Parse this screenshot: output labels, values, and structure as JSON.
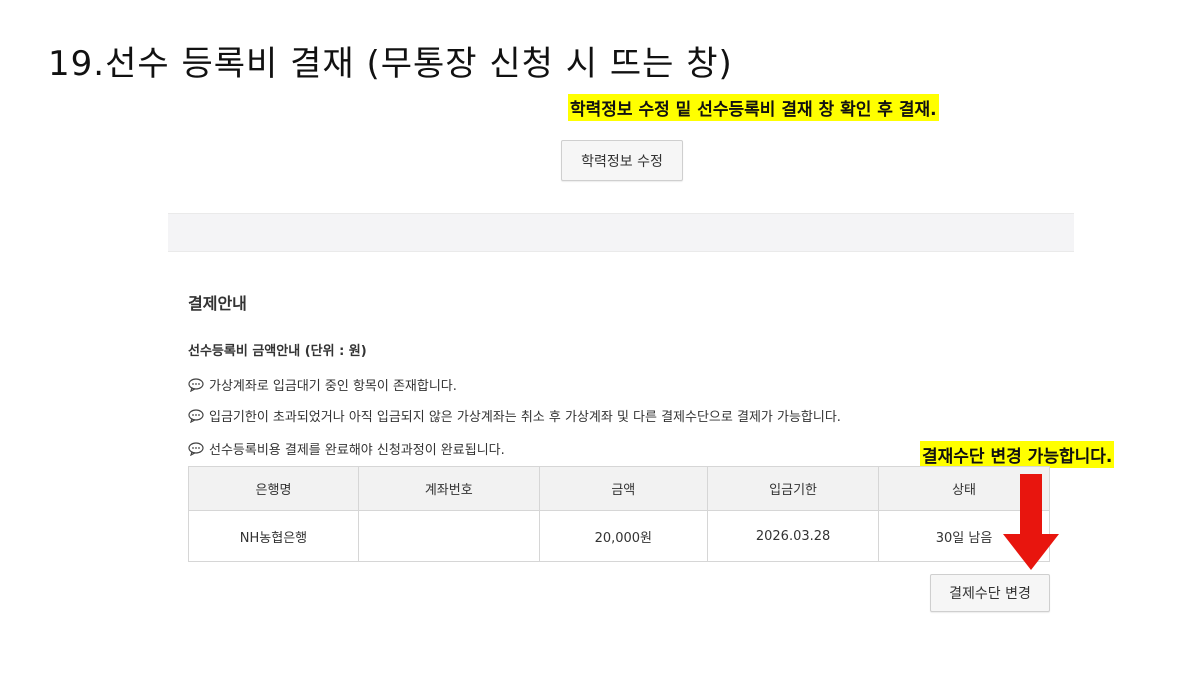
{
  "slide": {
    "title": "19.선수 등록비 결재 (무통장 신청 시 뜨는 창)"
  },
  "annotations": {
    "top": "학력정보 수정 밑 선수등록비 결재 창 확인 후 결재.",
    "right": "결재수단 변경 가능합니다."
  },
  "buttons": {
    "edit_education": "학력정보 수정",
    "change_payment": "결제수단 변경"
  },
  "payment": {
    "section_title": "결제안내",
    "fee_title": "선수등록비 금액안내 (단위 : 원)",
    "notes": [
      "가상계좌로 입금대기 중인 항목이 존재합니다.",
      "입금기한이 초과되었거나 아직 입금되지 않은 가상계좌는 취소 후 가상계좌 및 다른 결제수단으로 결제가 가능합니다.",
      "선수등록비용 결제를 완료해야 신청과정이 완료됩니다."
    ],
    "table": {
      "headers": [
        "은행명",
        "계좌번호",
        "금액",
        "입금기한",
        "상태"
      ],
      "rows": [
        {
          "bank": "NH농협은행",
          "account": "",
          "amount": "20,000원",
          "due": "2026.03.28",
          "status": "30일 남음"
        }
      ]
    }
  },
  "colors": {
    "highlight": "#ffff00",
    "arrow": "#e8150e",
    "band": "#f4f4f6"
  },
  "icons": {
    "note_icon": "chat-bubble-icon",
    "arrow": "arrow-down-icon"
  }
}
